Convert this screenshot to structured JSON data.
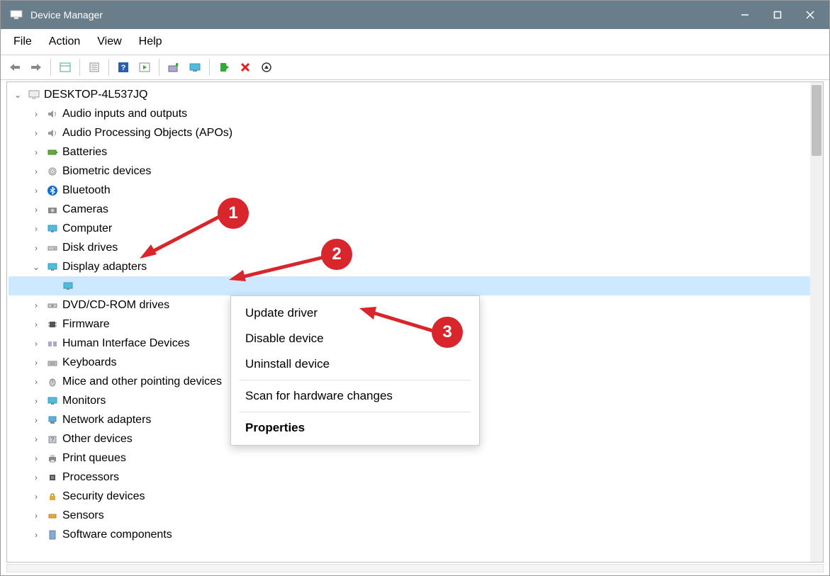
{
  "window": {
    "title": "Device Manager"
  },
  "menubar": [
    "File",
    "Action",
    "View",
    "Help"
  ],
  "tree": {
    "root": "DESKTOP-4L537JQ",
    "items": [
      "Audio inputs and outputs",
      "Audio Processing Objects (APOs)",
      "Batteries",
      "Biometric devices",
      "Bluetooth",
      "Cameras",
      "Computer",
      "Disk drives",
      "Display adapters",
      "DVD/CD-ROM drives",
      "Firmware",
      "Human Interface Devices",
      "Keyboards",
      "Mice and other pointing devices",
      "Monitors",
      "Network adapters",
      "Other devices",
      "Print queues",
      "Processors",
      "Security devices",
      "Sensors",
      "Software components"
    ]
  },
  "context_menu": {
    "update": "Update driver",
    "disable": "Disable device",
    "uninstall": "Uninstall device",
    "scan": "Scan for hardware changes",
    "props": "Properties"
  },
  "annotations": {
    "b1": "1",
    "b2": "2",
    "b3": "3"
  }
}
